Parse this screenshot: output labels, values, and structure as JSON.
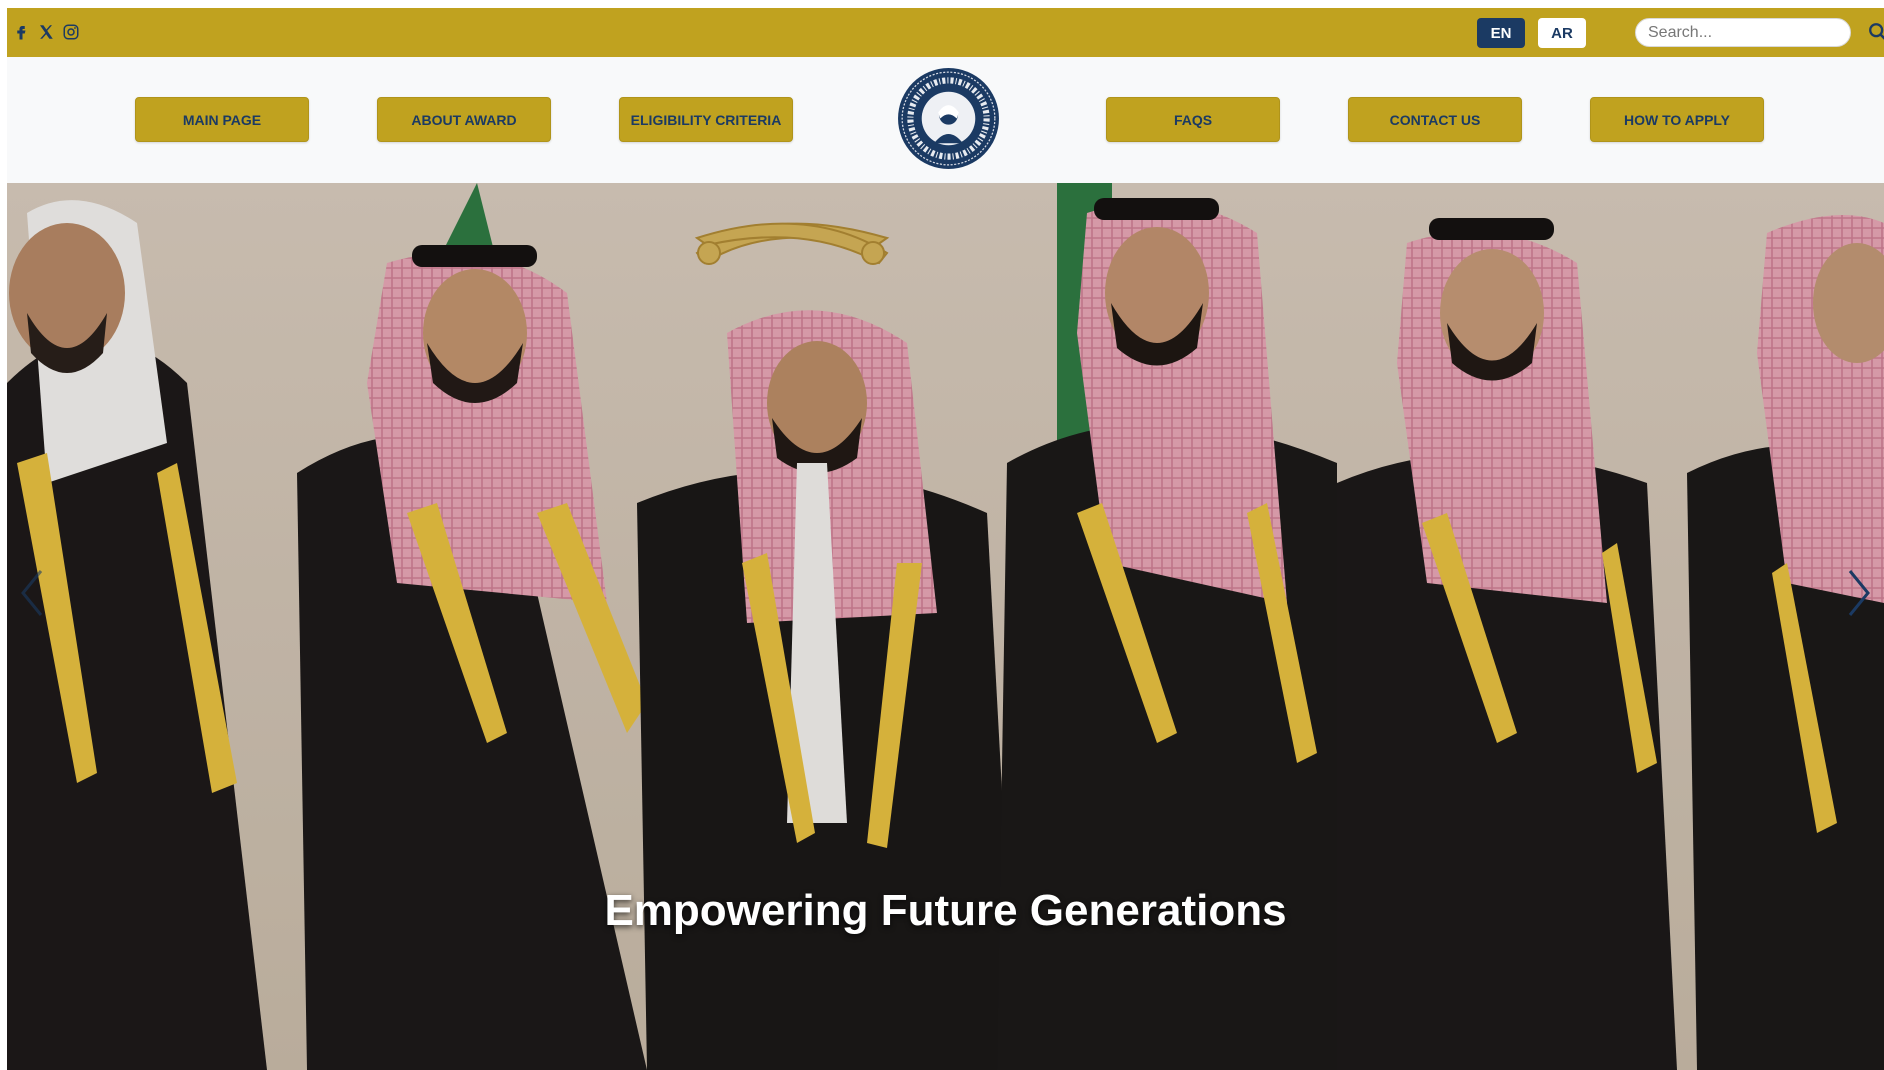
{
  "topbar": {
    "social": [
      "facebook-icon",
      "x-icon",
      "instagram-icon"
    ],
    "lang_en": "EN",
    "lang_ar": "AR",
    "search_placeholder": "Search..."
  },
  "nav": {
    "items": [
      "MAIN PAGE",
      "ABOUT AWARD",
      "ELIGIBILITY CRITERIA",
      "FAQS",
      "CONTACT US",
      "HOW TO APPLY"
    ]
  },
  "hero": {
    "caption": "Empowering Future Generations"
  },
  "colors": {
    "gold": "#c0a21f",
    "navy": "#1b3a63",
    "nav_bg": "#f8f9fa"
  }
}
